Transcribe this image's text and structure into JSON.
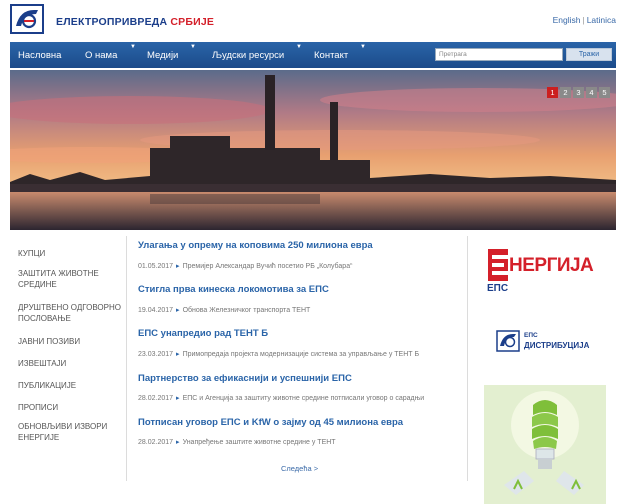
{
  "header": {
    "logo_text_blue": "ЕЛЕКТРОПРИВРЕДА ",
    "logo_text_red": "СРБИЈЕ",
    "lang_english": "English",
    "lang_latinica": "Latinica",
    "lang_sep": "|"
  },
  "nav": {
    "items": [
      "Насловна",
      "О нама",
      "Медији",
      "Људски ресурси",
      "Контакт"
    ],
    "search_placeholder": "Претрага",
    "search_button": "Тражи"
  },
  "hero": {
    "slides": [
      "1",
      "2",
      "3",
      "4",
      "5"
    ],
    "active_slide": "1"
  },
  "sidebar": {
    "items": [
      "КУПЦИ",
      "ЗАШТИТА ЖИВОТНЕ СРЕДИНЕ",
      "ДРУШТВЕНО ОДГОВОРНО ПОСЛОВАЊЕ",
      "ЈАВНИ ПОЗИВИ",
      "ИЗВЕШТАЈИ",
      "ПУБЛИКАЦИЈЕ",
      "ПРОПИСИ",
      "ОБНОВЉИВИ ИЗВОРИ ЕНЕРГИЈЕ"
    ]
  },
  "news": {
    "items": [
      {
        "title": "Улагања у опрему на коповима 250 милиона евра",
        "date": "01.05.2017",
        "summary": "Премијер Александар Вучић посетио РБ „Колубара“"
      },
      {
        "title": "Стигла прва кинеска локомотива за ЕПС",
        "date": "19.04.2017",
        "summary": "Обнова Железничког транспорта ТЕНТ"
      },
      {
        "title": "ЕПС унапредио рад ТЕНТ Б",
        "date": "23.03.2017",
        "summary": "Примопредаја пројекта модернизације система за управљање у ТЕНТ Б"
      },
      {
        "title": "Партнерство за ефикаснији и успешнији ЕПС",
        "date": "28.02.2017",
        "summary": "ЕПС и Агенција за заштиту животне средине потписали уговор о сарадњи"
      },
      {
        "title": "Потписан уговор ЕПС и KfW о зајму од 45 милиона евра",
        "date": "28.02.2017",
        "summary": "Унапређење заштите животне средине у ТЕНТ"
      }
    ],
    "more_label": "Следећа >"
  },
  "banners": {
    "energia_word": "НЕРГИЈА",
    "energia_eps": "ЕПС",
    "distrib_eps": "ЕПС",
    "distrib_word": "ДИСТРИБУЦИЈА"
  },
  "colors": {
    "brand_blue": "#1b4b8a",
    "brand_red": "#d4202a",
    "link_blue": "#2a64a8"
  }
}
